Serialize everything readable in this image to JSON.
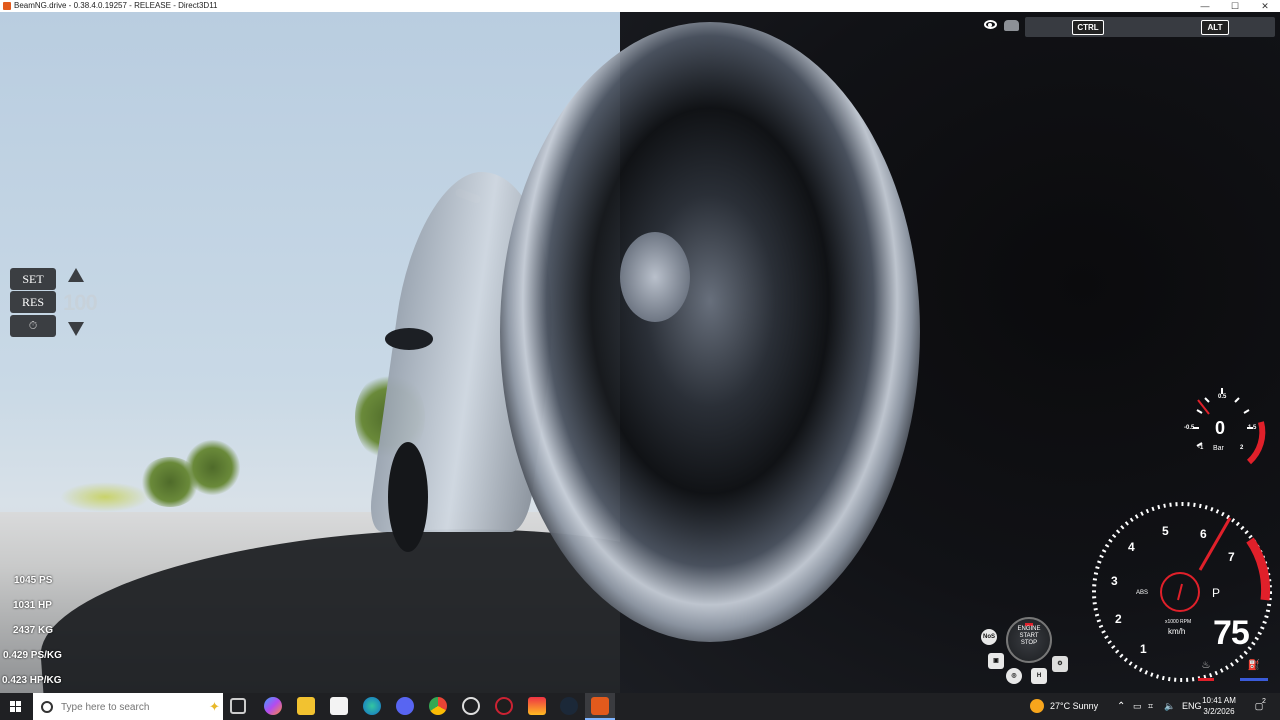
{
  "window": {
    "title": "BeamNG.drive - 0.38.4.0.19257 - RELEASE - Direct3D11",
    "min_glyph": "—",
    "max_glyph": "☐",
    "close_glyph": "✕"
  },
  "cruise_control": {
    "set_label": "SET",
    "res_label": "RES",
    "speed": "100"
  },
  "vehicle_stats": [
    "1045 PS",
    "1031 HP",
    "2437 KG",
    "0.429 PS/KG",
    "0.423 HP/KG"
  ],
  "top_controls": {
    "ctrl_label": "CTRL",
    "alt_label": "ALT"
  },
  "boost_gauge": {
    "value": "0",
    "unit": "Bar",
    "ticks": [
      "-0.5",
      "0.5",
      "1.5",
      "-1",
      "2"
    ]
  },
  "tacho": {
    "rpm_ticks": [
      "1",
      "2",
      "3",
      "4",
      "5",
      "6",
      "7"
    ],
    "rpm_unit": "x1000 RPM",
    "speed_unit": "km/h",
    "speed": "75",
    "gear": "P",
    "abs_label": "ABS"
  },
  "hud_buttons": {
    "nos_label": "NoS",
    "engine_label": "ENGINE",
    "start_label": "START",
    "stop_label": "STOP",
    "h_label": "H"
  },
  "taskbar": {
    "search_placeholder": "Type here to search",
    "weather": "27°C  Sunny",
    "language": "ENG",
    "time": "10:41 AM",
    "date": "3/2/2026",
    "notifications": "2"
  },
  "colors": {
    "accent_red": "#e0202a",
    "taskbar_bg": "#1f2023",
    "hud_panel": "#3b3e42"
  }
}
